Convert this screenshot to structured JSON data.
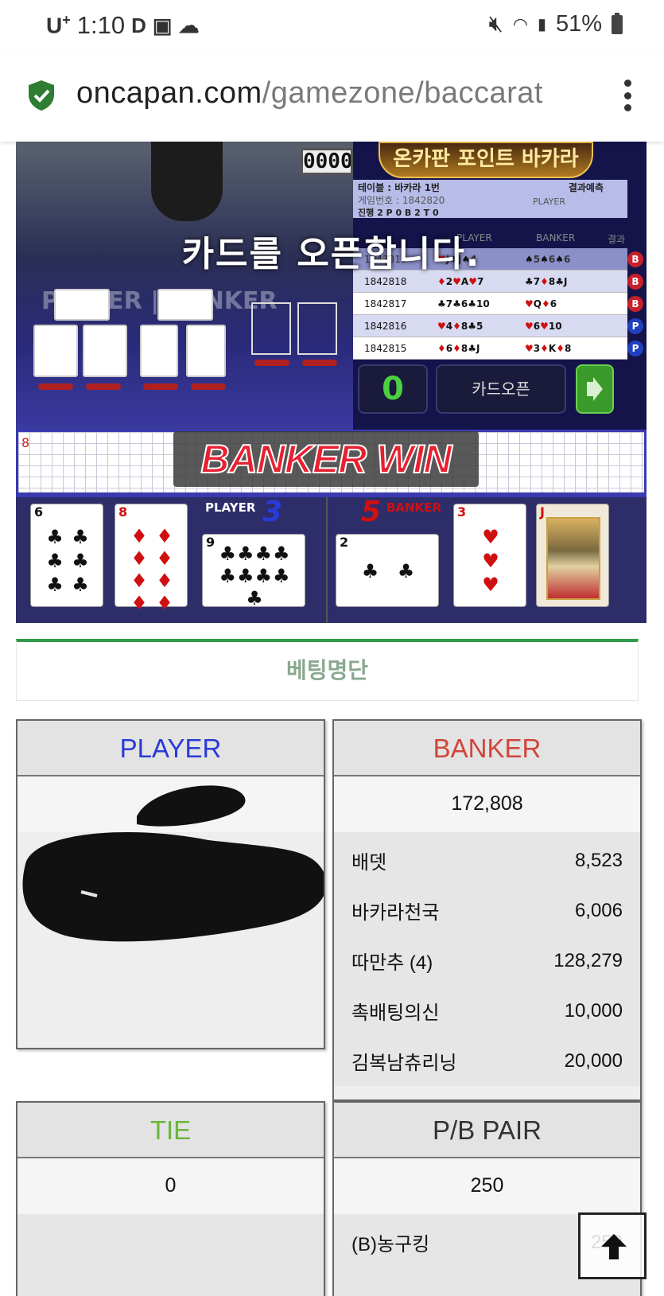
{
  "status_bar": {
    "carrier": "U",
    "carrier_sup": "+",
    "time": "1:10",
    "icons": [
      "d-app-icon",
      "gallery-icon",
      "cloud-icon"
    ],
    "right_icons": [
      "mute-icon",
      "wifi-icon",
      "signal-icon"
    ],
    "battery": "51%"
  },
  "browser": {
    "host": "oncapan.com",
    "path": "/gamezone/baccarat",
    "security_icon": "shield-check-icon",
    "menu_icon": "vertical-dots-icon",
    "accent": "#2e7d32"
  },
  "game": {
    "counter": "0000",
    "open_message": "카드를 오픈합니다.",
    "table_labels": "PLAYER | BANKER",
    "brand": "온카판 포인트 바카라",
    "info_table": "테이블 : 바카라 1번",
    "info_round": "게임번호 : 1842820",
    "info_progress": "진행 2   P 0   B 2   T 0",
    "info_predict": "결과예측",
    "info_player": "PLAYER",
    "history_header": {
      "player": "PLAYER",
      "banker": "BANKER",
      "result": "결과"
    },
    "history": [
      {
        "id": "1842819",
        "player": "♥J♠J♠4",
        "banker": "♠5♠6♠6",
        "result": "B"
      },
      {
        "id": "1842818",
        "player": "♦2♥A♥7",
        "banker": "♣7♦8♣J",
        "result": "B"
      },
      {
        "id": "1842817",
        "player": "♣7♣6♣10",
        "banker": "♥Q♦6",
        "result": "B"
      },
      {
        "id": "1842816",
        "player": "♥4♦8♣5",
        "banker": "♥6♥10",
        "result": "P"
      },
      {
        "id": "1842815",
        "player": "♦6♦8♣J",
        "banker": "♥3♦K♦8",
        "result": "P"
      }
    ],
    "controls": {
      "count": "0",
      "open_button": "카드오픈",
      "sound_icon": "speaker-icon"
    },
    "road_number": "8",
    "win_banner": "BANKER WIN",
    "player_label": "PLAYER",
    "player_score": "3",
    "banker_label": "BANKER",
    "banker_score": "5",
    "player_cards": [
      {
        "rank": "6",
        "suit": "♣",
        "color": "black"
      },
      {
        "rank": "8",
        "suit": "♦",
        "color": "red"
      },
      {
        "rank": "9",
        "suit": "♣",
        "color": "black"
      }
    ],
    "banker_cards": [
      {
        "rank": "2",
        "suit": "♣",
        "color": "black"
      },
      {
        "rank": "3",
        "suit": "♥",
        "color": "red"
      },
      {
        "rank": "J",
        "suit": "♦",
        "color": "red"
      }
    ]
  },
  "betting": {
    "title": "베팅명단",
    "player": {
      "label": "PLAYER",
      "color": "#2a3ad8"
    },
    "banker": {
      "label": "BANKER",
      "color": "#d0453a",
      "total": "172,808",
      "rows": [
        {
          "name": "배뎃",
          "amount": "8,523"
        },
        {
          "name": "바카라천국",
          "amount": "6,006"
        },
        {
          "name": "따만추 (4)",
          "amount": "128,279"
        },
        {
          "name": "촉배팅의신",
          "amount": "10,000"
        },
        {
          "name": "김복남츄리닝",
          "amount": "20,000"
        }
      ]
    },
    "tie": {
      "label": "TIE",
      "color": "#6ab63a",
      "total": "0"
    },
    "pair": {
      "label": "P/B PAIR",
      "total": "250",
      "rows": [
        {
          "name": "(B)농구킹",
          "amount": "250"
        }
      ]
    }
  },
  "scroll_top_icon": "arrow-up-icon"
}
